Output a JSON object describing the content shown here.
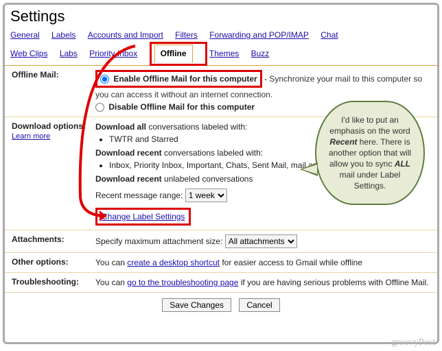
{
  "title": "Settings",
  "tabs": {
    "general": "General",
    "labels": "Labels",
    "accounts": "Accounts and Import",
    "filters": "Filters",
    "forwarding": "Forwarding and POP/IMAP",
    "chat": "Chat",
    "webclips": "Web Clips",
    "labs": "Labs",
    "priority": "Priority Inbox",
    "offline": "Offline",
    "themes": "Themes",
    "buzz": "Buzz"
  },
  "offline_mail": {
    "label": "Offline Mail:",
    "enable_label": "Enable Offline Mail for this computer",
    "enable_desc": " - Synchronize your mail to this computer so you can access it without an internet connection.",
    "disable_label": "Disable Offline Mail for this computer"
  },
  "download": {
    "label": "Download options:",
    "learn_more": "Learn more",
    "all_head": "Download all",
    "all_tail": " conversations labeled with:",
    "all_items": "TWTR and Starred",
    "recent_head": "Download recent",
    "recent_tail": " conversations labeled with:",
    "recent_items": "Inbox, Priority Inbox, Important, Chats, Sent Mail, mail and SU.PR",
    "unlabeled_head": "Download recent",
    "unlabeled_tail": " unlabeled conversations",
    "range_label": "Recent message range:",
    "range_value": "1 week",
    "change_link": "Change Label Settings"
  },
  "attachments": {
    "label": "Attachments:",
    "text": "Specify maximum attachment size:",
    "value": "All attachments"
  },
  "other": {
    "label": "Other options:",
    "pre": "You can ",
    "link": "create a desktop shortcut",
    "post": " for easier access to Gmail while offline"
  },
  "trouble": {
    "label": "Troubleshooting:",
    "pre": "You can ",
    "link": "go to the troubleshooting page",
    "post": " if you are having serious problems with Offline Mail."
  },
  "buttons": {
    "save": "Save Changes",
    "cancel": "Cancel"
  },
  "callout": {
    "l1": "I'd like to put an emphasis on the word ",
    "emph1": "Recent",
    "l2": " here. There is another option that will allow you to sync ",
    "emph2": "ALL",
    "l3": " mail under Label Settings."
  },
  "watermark": "groovyPost"
}
